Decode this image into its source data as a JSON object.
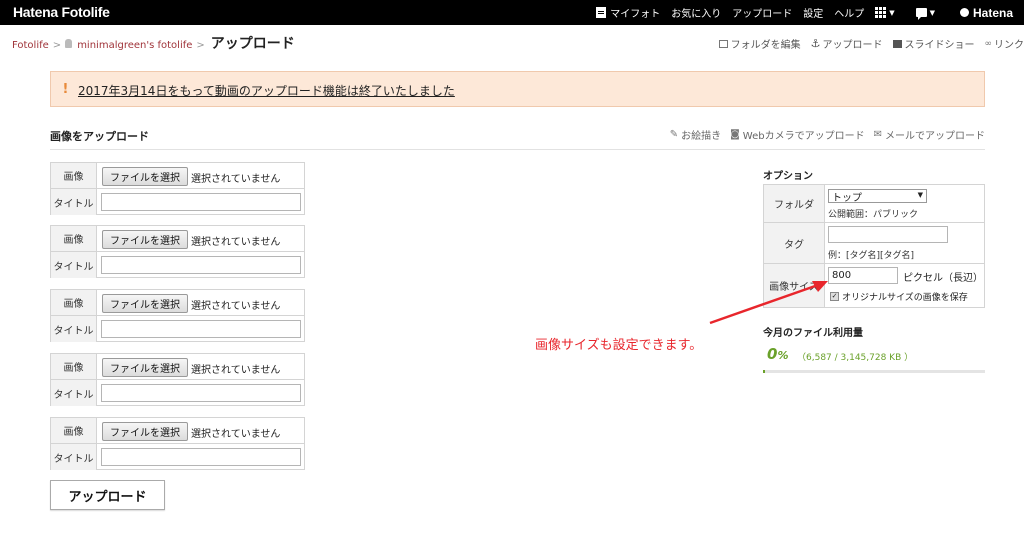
{
  "topbar": {
    "logo": "Hatena Fotolife",
    "nav": [
      "マイフォト",
      "お気に入り",
      "アップロード",
      "設定",
      "ヘルプ"
    ],
    "brand": "Hatena"
  },
  "breadcrumb": {
    "root": "Fotolife",
    "user": "minimalgreen's fotolife",
    "current": "アップロード"
  },
  "toolbar": {
    "edit_folder": "フォルダを編集",
    "upload": "アップロード",
    "slideshow": "スライドショー",
    "link": "リンク"
  },
  "notice": {
    "icon": "!",
    "message": "2017年3月14日をもって動画のアップロード機能は終了いたしました"
  },
  "section": {
    "title": "画像をアップロード",
    "links": [
      "お絵描き",
      "Webカメラでアップロード",
      "メールでアップロード"
    ]
  },
  "file_fields": [
    {
      "image_label": "画像",
      "choose_button": "ファイルを選択",
      "status": "選択されていません",
      "title_label": "タイトル",
      "title_value": ""
    },
    {
      "image_label": "画像",
      "choose_button": "ファイルを選択",
      "status": "選択されていません",
      "title_label": "タイトル",
      "title_value": ""
    },
    {
      "image_label": "画像",
      "choose_button": "ファイルを選択",
      "status": "選択されていません",
      "title_label": "タイトル",
      "title_value": ""
    },
    {
      "image_label": "画像",
      "choose_button": "ファイルを選択",
      "status": "選択されていません",
      "title_label": "タイトル",
      "title_value": ""
    },
    {
      "image_label": "画像",
      "choose_button": "ファイルを選択",
      "status": "選択されていません",
      "title_label": "タイトル",
      "title_value": ""
    }
  ],
  "upload_button": "アップロード",
  "options": {
    "title": "オプション",
    "folder_label": "フォルダ",
    "folder_value": "トップ",
    "folder_scope": "公開範囲：パブリック",
    "tag_label": "タグ",
    "tag_value": "",
    "tag_example": "例：[タグ名][タグ名]",
    "size_label": "画像サイズ",
    "size_value": "800",
    "size_unit": "ピクセル（長辺）",
    "keep_original": "オリジナルサイズの画像を保存",
    "keep_original_checked": true
  },
  "usage": {
    "title": "今月のファイル利用量",
    "percent": "0",
    "percent_sign": "%",
    "detail": "（6,587 / 3,145,728 KB ）",
    "fraction": 0.002
  },
  "annotation": "画像サイズも設定できます。",
  "colors": {
    "accent_green": "#6aa12a",
    "annotation_red": "#e8262c",
    "notice_bg": "#fde8d8",
    "link_red": "#a0343a"
  }
}
